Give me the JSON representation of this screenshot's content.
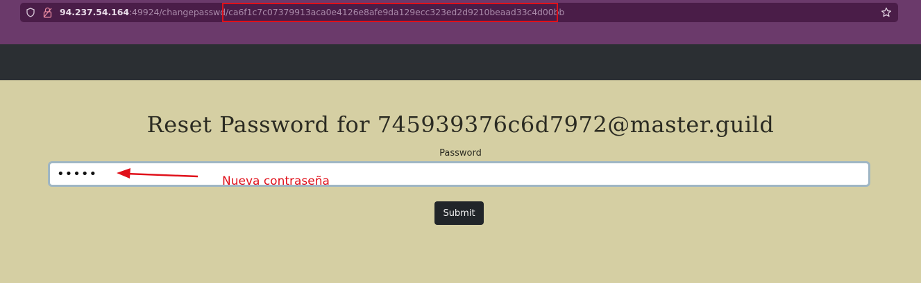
{
  "browser": {
    "url_host": "94.237.54.164",
    "url_port": ":49924",
    "url_path": "/changepasswd/",
    "url_token": "ca6f1c7c07379913aca0e4126e8afe9da129ecc323ed2d9210beaad33c4d00bb"
  },
  "page": {
    "title": "Reset Password for 745939376c6d7972@master.guild",
    "password_label": "Password",
    "password_value": "12345",
    "submit_label": "Submit"
  },
  "annotation": {
    "label": "Nueva contraseña",
    "color": "#e0101a"
  },
  "colors": {
    "browser_bg": "#6b3a6b",
    "urlbar_bg": "#4a1d48",
    "navbar_bg": "#2b2f33",
    "page_bg": "#d5cfa3",
    "button_bg": "#212529"
  }
}
